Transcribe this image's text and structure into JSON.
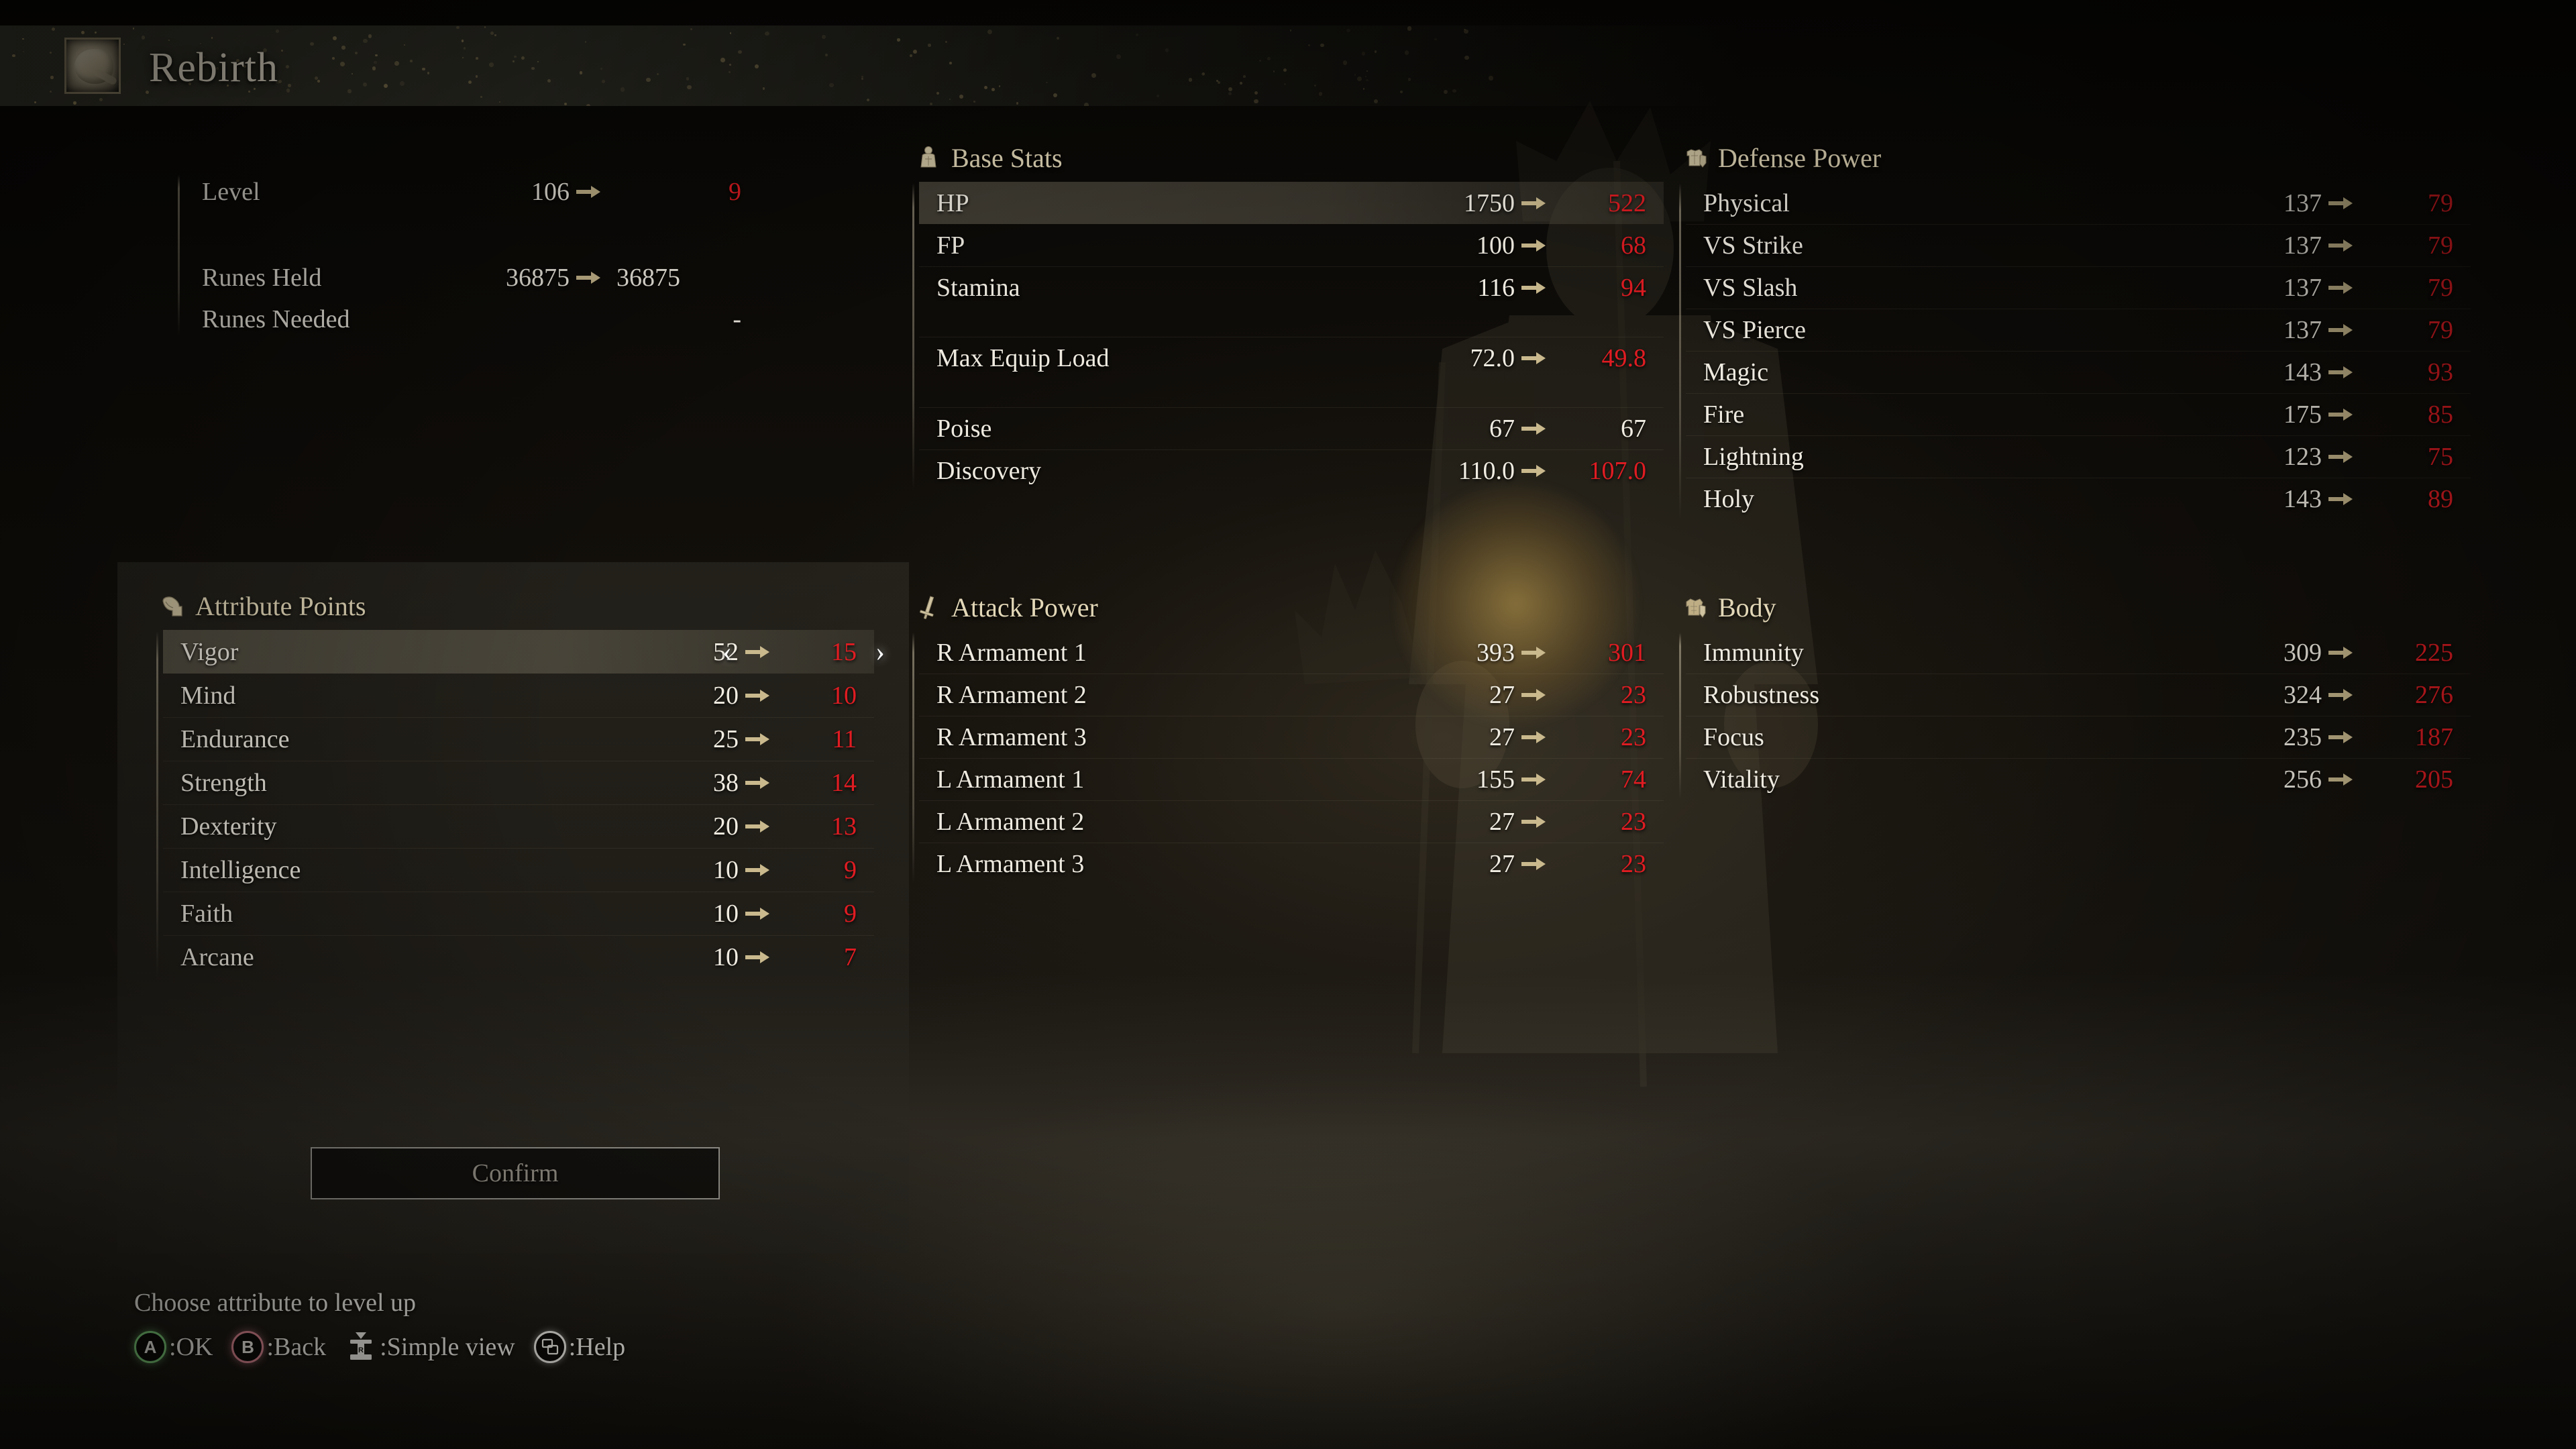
{
  "header": {
    "title": "Rebirth",
    "icon": "larval-tear-icon"
  },
  "level_info": {
    "rows": [
      {
        "label": "Level",
        "old": "106",
        "new": "9",
        "changed": true
      },
      {
        "label": "Runes Held",
        "old": "36875",
        "new": "36875",
        "changed": false
      },
      {
        "label": "Runes Needed",
        "old": "",
        "new": "-",
        "changed": false
      }
    ]
  },
  "attribute_points": {
    "title": "Attribute Points",
    "icon": "flexed-bicep-icon",
    "confirm_label": "Confirm",
    "chevron_left": "‹",
    "chevron_right": "›",
    "rows": [
      {
        "label": "Vigor",
        "old": "52",
        "new": "15",
        "changed": true,
        "selected": true
      },
      {
        "label": "Mind",
        "old": "20",
        "new": "10",
        "changed": true,
        "selected": false
      },
      {
        "label": "Endurance",
        "old": "25",
        "new": "11",
        "changed": true,
        "selected": false
      },
      {
        "label": "Strength",
        "old": "38",
        "new": "14",
        "changed": true,
        "selected": false
      },
      {
        "label": "Dexterity",
        "old": "20",
        "new": "13",
        "changed": true,
        "selected": false
      },
      {
        "label": "Intelligence",
        "old": "10",
        "new": "9",
        "changed": true,
        "selected": false
      },
      {
        "label": "Faith",
        "old": "10",
        "new": "9",
        "changed": true,
        "selected": false
      },
      {
        "label": "Arcane",
        "old": "10",
        "new": "7",
        "changed": true,
        "selected": false
      }
    ]
  },
  "base_stats": {
    "title": "Base Stats",
    "icon": "torso-figure-icon",
    "rows": [
      {
        "label": "HP",
        "old": "1750",
        "new": "522",
        "changed": true,
        "selected": true
      },
      {
        "label": "FP",
        "old": "100",
        "new": "68",
        "changed": true,
        "selected": false
      },
      {
        "label": "Stamina",
        "old": "116",
        "new": "94",
        "changed": true,
        "selected": false
      },
      {
        "label": "",
        "spacer": true
      },
      {
        "label": "Max Equip Load",
        "old": "72.0",
        "new": "49.8",
        "changed": true,
        "selected": false
      },
      {
        "label": "",
        "spacer": true
      },
      {
        "label": "Poise",
        "old": "67",
        "new": "67",
        "changed": false,
        "selected": false
      },
      {
        "label": "Discovery",
        "old": "110.0",
        "new": "107.0",
        "changed": true,
        "selected": false
      }
    ]
  },
  "attack_power": {
    "title": "Attack Power",
    "icon": "sword-icon",
    "rows": [
      {
        "label": "R Armament 1",
        "old": "393",
        "new": "301",
        "changed": true
      },
      {
        "label": "R Armament 2",
        "old": "27",
        "new": "23",
        "changed": true
      },
      {
        "label": "R Armament 3",
        "old": "27",
        "new": "23",
        "changed": true
      },
      {
        "label": "L Armament 1",
        "old": "155",
        "new": "74",
        "changed": true
      },
      {
        "label": "L Armament 2",
        "old": "27",
        "new": "23",
        "changed": true
      },
      {
        "label": "L Armament 3",
        "old": "27",
        "new": "23",
        "changed": true
      }
    ]
  },
  "defense_power": {
    "title": "Defense Power",
    "icon": "armor-shield-icon",
    "rows": [
      {
        "label": "Physical",
        "old": "137",
        "new": "79",
        "changed": true
      },
      {
        "label": "VS Strike",
        "old": "137",
        "new": "79",
        "changed": true
      },
      {
        "label": "VS Slash",
        "old": "137",
        "new": "79",
        "changed": true
      },
      {
        "label": "VS Pierce",
        "old": "137",
        "new": "79",
        "changed": true
      },
      {
        "label": "Magic",
        "old": "143",
        "new": "93",
        "changed": true
      },
      {
        "label": "Fire",
        "old": "175",
        "new": "85",
        "changed": true
      },
      {
        "label": "Lightning",
        "old": "123",
        "new": "75",
        "changed": true
      },
      {
        "label": "Holy",
        "old": "143",
        "new": "89",
        "changed": true
      }
    ]
  },
  "body_stats": {
    "title": "Body",
    "icon": "body-armor-icon",
    "rows": [
      {
        "label": "Immunity",
        "old": "309",
        "new": "225",
        "changed": true
      },
      {
        "label": "Robustness",
        "old": "324",
        "new": "276",
        "changed": true
      },
      {
        "label": "Focus",
        "old": "235",
        "new": "187",
        "changed": true
      },
      {
        "label": "Vitality",
        "old": "256",
        "new": "205",
        "changed": true
      }
    ]
  },
  "footer": {
    "hint": "Choose attribute to level up",
    "prompts": [
      {
        "glyph": "A",
        "kind": "a",
        "label": ":OK"
      },
      {
        "glyph": "B",
        "kind": "b",
        "label": ":Back"
      },
      {
        "glyph": "",
        "kind": "stick",
        "label": ":Simple view"
      },
      {
        "glyph": "",
        "kind": "help",
        "label": ":Help"
      }
    ]
  },
  "colors": {
    "decreased_value": "#e01c22",
    "unchanged_value": "#f0ece2",
    "label_text": "#eeeae0",
    "section_title": "#e2d7b7",
    "arrow": "#c9b98d",
    "confirm_text": "#9a958b"
  }
}
